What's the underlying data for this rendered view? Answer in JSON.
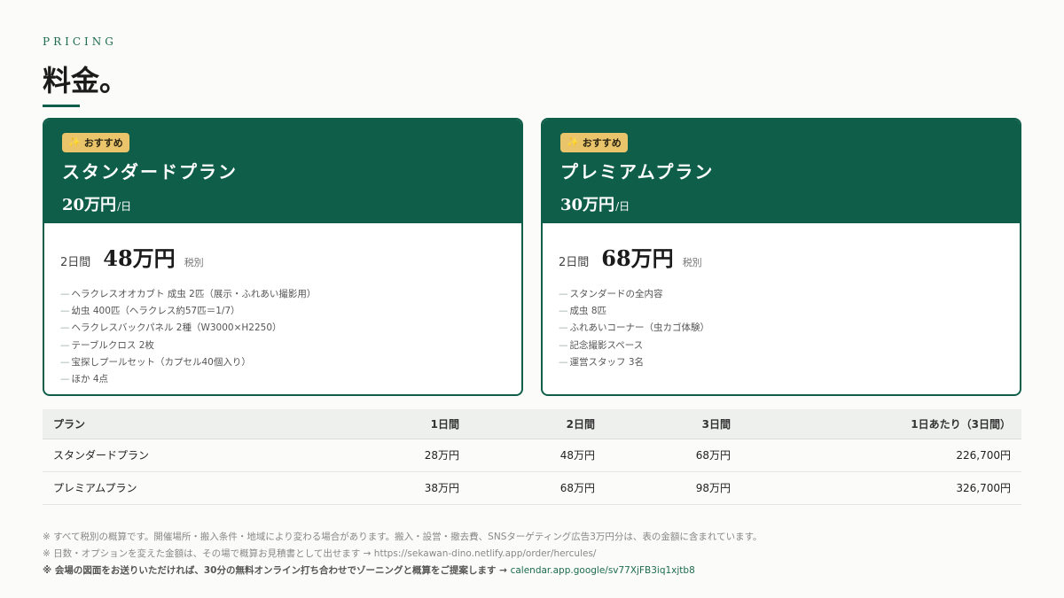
{
  "header": {
    "eyebrow": "PRICING",
    "title": "料金。"
  },
  "plans": [
    {
      "badge": "おすすめ",
      "badge_icon": "star-icon",
      "name": "スタンダードプラン",
      "day_price": "20万円",
      "day_unit": "/日",
      "pkg_label": "2日間",
      "pkg_price": "48万円",
      "pkg_tax": "税別",
      "features": [
        "ヘラクレスオオカブト 成虫 2匹（展示・ふれあい撮影用）",
        "幼虫 400匹（ヘラクレス約57匹＝1/7）",
        "ヘラクレスバックパネル 2種（W3000×H2250）",
        "テーブルクロス 2枚",
        "宝探しプールセット（カプセル40個入り）",
        "ほか 4点"
      ]
    },
    {
      "badge": "おすすめ",
      "badge_icon": "star-icon",
      "name": "プレミアムプラン",
      "day_price": "30万円",
      "day_unit": "/日",
      "pkg_label": "2日間",
      "pkg_price": "68万円",
      "pkg_tax": "税別",
      "features": [
        "スタンダードの全内容",
        "成虫 8匹",
        "ふれあいコーナー（虫カゴ体験）",
        "記念撮影スペース",
        "運営スタッフ 3名"
      ]
    }
  ],
  "feature_dash": "—",
  "table": {
    "headers": [
      "プラン",
      "1日間",
      "2日間",
      "3日間",
      "1日あたり（3日間）"
    ],
    "rows": [
      [
        "スタンダードプラン",
        "28万円",
        "48万円",
        "68万円",
        "226,700円"
      ],
      [
        "プレミアムプラン",
        "38万円",
        "68万円",
        "98万円",
        "326,700円"
      ]
    ]
  },
  "notes": {
    "line1": "※ すべて税別の概算です。開催場所・搬入条件・地域により変わる場合があります。搬入・設営・撤去費、SNSターゲティング広告3万円分は、表の金額に含まれています。",
    "line2_text": "※ 日数・オプションを変えた金額は、その場で概算お見積書として出せます → ",
    "line2_link": "https://sekawan-dino.netlify.app/order/hercules/",
    "line3_text": "※ 会場の図面をお送りいただければ、30分の無料オンライン打ち合わせでゾーニングと概算をご提案します → ",
    "line3_link": "calendar.app.google/sv77XjFB3iq1xjtb8"
  },
  "colors": {
    "brand": "#0f5e4a",
    "badge": "#e9c46a"
  }
}
